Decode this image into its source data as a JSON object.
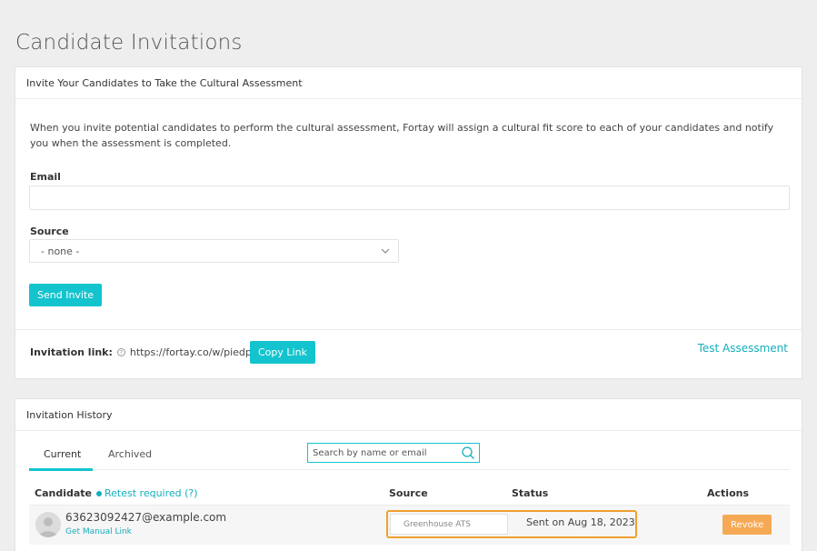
{
  "page": {
    "title": "Candidate Invitations"
  },
  "invite_panel": {
    "title": "Invite Your Candidates to Take the Cultural Assessment",
    "description": "When you invite potential candidates to perform the cultural assessment, Fortay will assign a cultural fit score to each of your candidates and notify you when the assessment is completed.",
    "email_label": "Email",
    "email_value": "",
    "source_label": "Source",
    "source_selected": "- none -",
    "send_button": "Send Invite",
    "invitation_link_label": "Invitation link:",
    "invitation_link_url": "https://fortay.co/w/piedpiper",
    "copy_button": "Copy Link",
    "test_assessment_link": "Test Assessment"
  },
  "history_panel": {
    "title": "Invitation History",
    "tabs": [
      {
        "label": "Current",
        "active": true
      },
      {
        "label": "Archived",
        "active": false
      }
    ],
    "search_placeholder": "Search by name or email",
    "columns": {
      "candidate": "Candidate",
      "retest": "Retest required (?)",
      "source": "Source",
      "status": "Status",
      "actions": "Actions"
    },
    "rows": [
      {
        "email": "63623092427@example.com",
        "manual_link": "Get Manual Link",
        "source": "Greenhouse ATS",
        "status": "Sent on Aug 18, 2023",
        "action": "Revoke"
      }
    ]
  },
  "colors": {
    "accent": "#13c4ce",
    "link": "#13aebb",
    "revoke": "#f6a955",
    "highlight": "#f0a030"
  },
  "icons": {
    "help": "help-circle-icon",
    "chevron": "chevron-down-icon",
    "search": "search-icon",
    "avatar": "user-avatar-icon"
  }
}
